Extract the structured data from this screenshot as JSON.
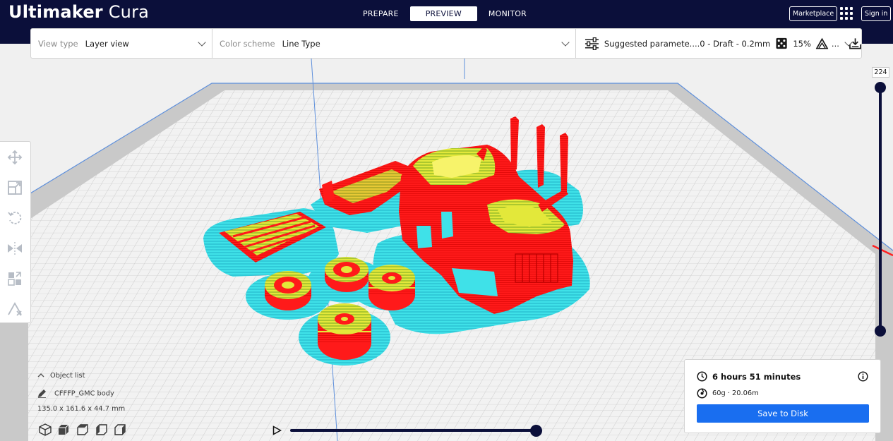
{
  "app": {
    "logo_bold": "Ultimaker",
    "logo_light": "Cura"
  },
  "header": {
    "tabs": [
      {
        "label": "PREPARE",
        "active": false
      },
      {
        "label": "PREVIEW",
        "active": true
      },
      {
        "label": "MONITOR",
        "active": false
      }
    ],
    "marketplace_label": "Marketplace",
    "signin_label": "Sign in",
    "apps_icon": "apps-grid-icon"
  },
  "toolbar": {
    "view_type_label": "View type",
    "view_type_value": "Layer view",
    "color_scheme_label": "Color scheme",
    "color_scheme_value": "Line Type",
    "profile_text": "Suggested paramete....0 - Draft - 0.2mm",
    "infill_value": "15%",
    "support_ellipsis": "..."
  },
  "layer_slider": {
    "current_layer": "224"
  },
  "object_list": {
    "title": "Object list",
    "object_name": "CFFFP_GMC body",
    "dimensions": "135.0 x 161.6 x 44.7 mm"
  },
  "print_info": {
    "time": "6 hours 51 minutes",
    "material": "60g · 20.06m",
    "save_label": "Save to Disk"
  },
  "colors": {
    "header_bg": "#0b0f3a",
    "accent": "#196ef0",
    "model_red": "#ff1a1a",
    "infill_yellow": "#e3e83a",
    "support_cyan": "#3fe1e8"
  }
}
